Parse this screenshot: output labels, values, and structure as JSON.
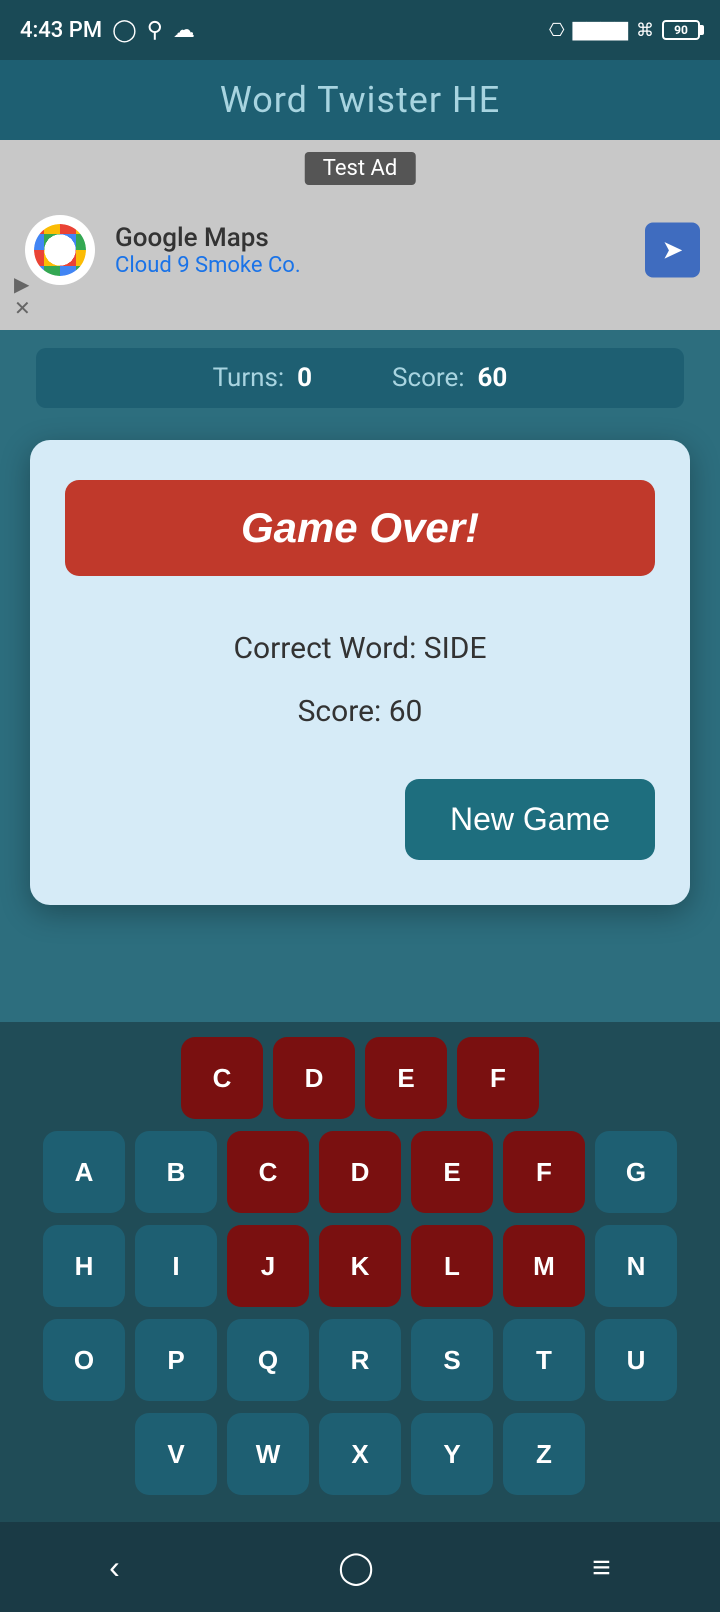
{
  "statusBar": {
    "time": "4:43 PM",
    "battery": "90"
  },
  "appTitle": "Word Twister HE",
  "ad": {
    "label": "Test Ad",
    "company": "Google Maps",
    "subtitle": "Cloud 9 Smoke Co."
  },
  "scoreBar": {
    "turnsLabel": "Turns:",
    "turnsValue": "0",
    "scoreLabel": "Score:",
    "scoreValue": "60"
  },
  "dialog": {
    "gameOverLabel": "Game Over!",
    "correctWordLabel": "Correct Word: SIDE",
    "scoreLabel": "Score: 60",
    "newGameLabel": "New Game"
  },
  "keyboard": {
    "rows": [
      [
        "A",
        "B",
        "C",
        "D",
        "E",
        "F",
        "G"
      ],
      [
        "H",
        "I",
        "J",
        "K",
        "L",
        "M",
        "N"
      ],
      [
        "O",
        "P",
        "Q",
        "R",
        "S",
        "T",
        "U"
      ],
      [
        "V",
        "W",
        "X",
        "Y",
        "Z"
      ]
    ],
    "usedWrong": [
      "C",
      "D",
      "E",
      "F",
      "J",
      "K",
      "L",
      "M"
    ]
  }
}
